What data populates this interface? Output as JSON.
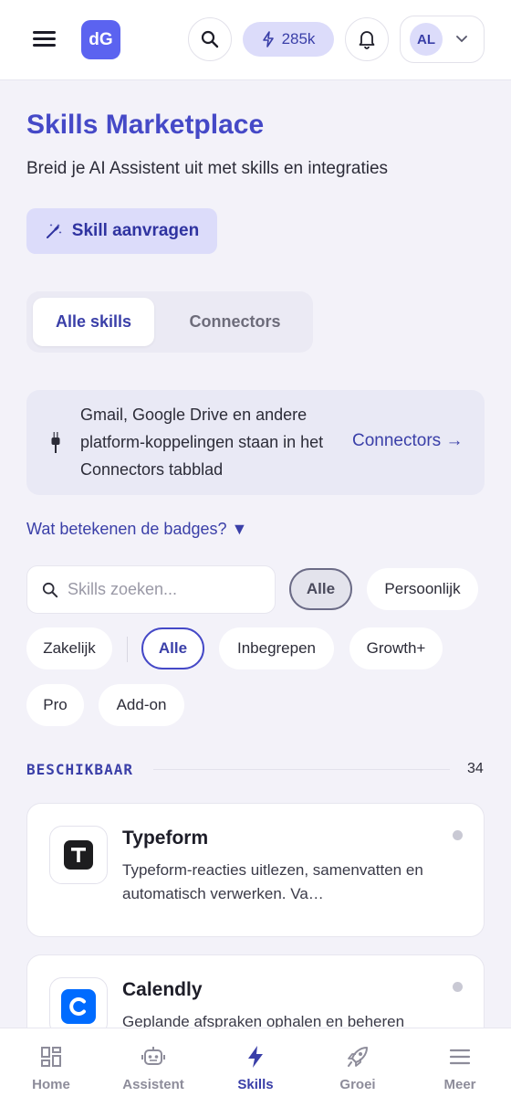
{
  "header": {
    "logo_text": "dG",
    "credits_label": "285k",
    "avatar_initials": "AL"
  },
  "main": {
    "title": "Skills Marketplace",
    "subtitle": "Breid je AI Assistent uit met skills en integraties",
    "request_button_label": "Skill aanvragen",
    "tabs": [
      {
        "label": "Alle skills",
        "active": true
      },
      {
        "label": "Connectors",
        "active": false
      }
    ],
    "info": {
      "text": "Gmail, Google Drive en andere platform-koppelingen staan in het Connectors tabblad",
      "link_label": "Connectors →"
    },
    "badges_toggle_label": "Wat betekenen de badges? ▼",
    "search": {
      "placeholder": "Skills zoeken...",
      "value": ""
    },
    "filters": {
      "scope": [
        "Alle",
        "Persoonlijk",
        "Zakelijk"
      ],
      "scope_selected": "Alle",
      "tier": [
        "Alle",
        "Inbegrepen",
        "Growth+",
        "Pro",
        "Add-on"
      ],
      "tier_selected": "Alle"
    },
    "section": {
      "label": "BESCHIKBAAR",
      "count": "34"
    },
    "skills": [
      {
        "name": "Typeform",
        "description": "Typeform-reacties uitlezen, samenvatten en automatisch verwerken. Va…",
        "icon": "typeform-icon",
        "icon_letter": "T",
        "icon_bg": "#1d1d1f"
      },
      {
        "name": "Calendly",
        "description": "Geplande afspraken ophalen en beheren",
        "icon": "calendly-icon",
        "icon_letter": "C",
        "icon_bg": "#006bff"
      }
    ]
  },
  "bottom_nav": [
    {
      "label": "Home",
      "icon": "home-grid-icon",
      "active": false
    },
    {
      "label": "Assistent",
      "icon": "robot-icon",
      "active": false
    },
    {
      "label": "Skills",
      "icon": "lightning-icon",
      "active": true
    },
    {
      "label": "Groei",
      "icon": "rocket-icon",
      "active": false
    },
    {
      "label": "Meer",
      "icon": "menu-icon",
      "active": false
    }
  ],
  "colors": {
    "accent": "#4549c7",
    "accent_soft": "#dcdcfa",
    "background": "#f3f2f9"
  }
}
